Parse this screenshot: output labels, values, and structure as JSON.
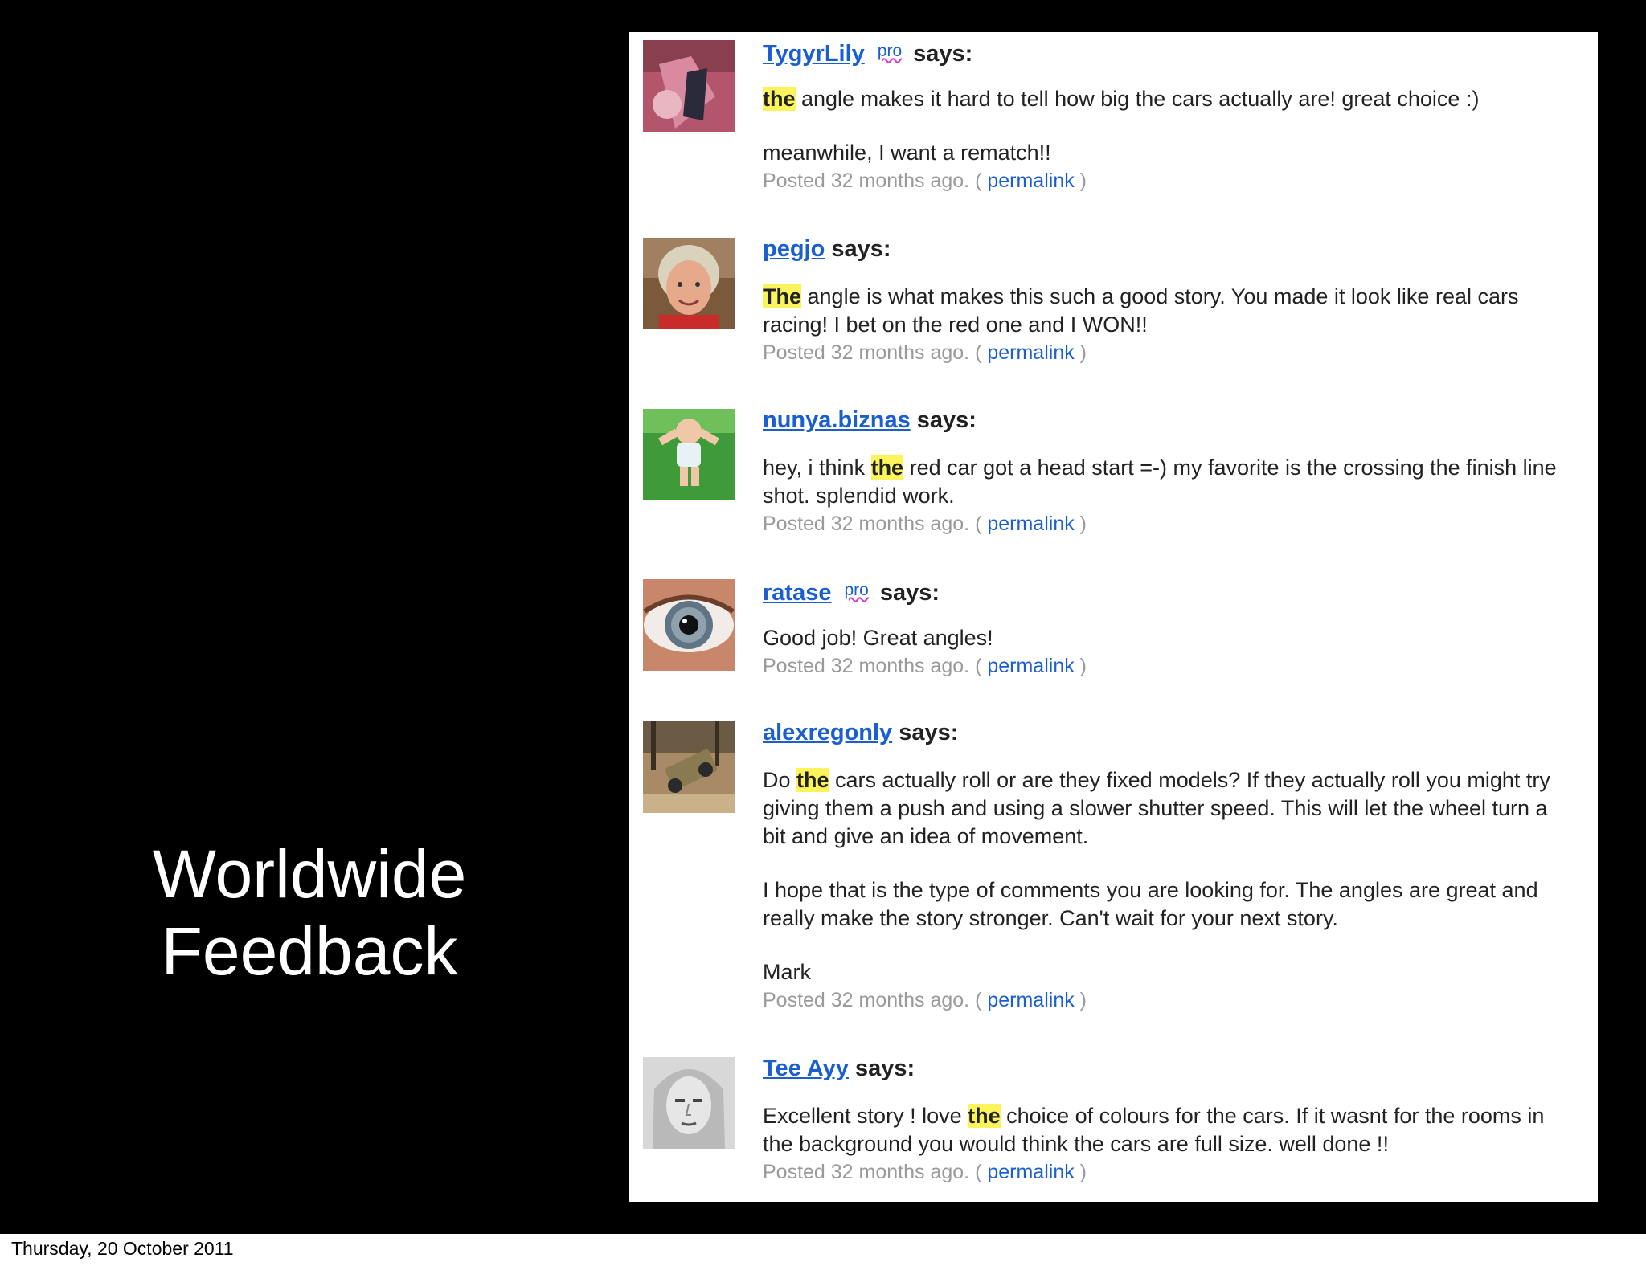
{
  "slide": {
    "title_line1": "Worldwide",
    "title_line2": "Feedback",
    "date": "Thursday, 20 October 2011",
    "background": "#000000"
  },
  "comments": [
    {
      "username": "TygyrLily",
      "badge": "pro",
      "says": "says:",
      "p1_hl": "the",
      "p1_rest": " angle makes it hard to tell how big the cars actually are! great choice :)",
      "p2": "meanwhile, I want a rematch!!",
      "posted": "Posted 32 months ago. (",
      "permalink": "permalink",
      "close": ")"
    },
    {
      "username": "pegjo",
      "says": "says:",
      "p1_hl": "The",
      "p1_rest": " angle is what makes this such a good story. You made it look like real cars racing! I bet on the red one and I WON!!",
      "posted": "Posted 32 months ago. (",
      "permalink": "permalink",
      "close": ")"
    },
    {
      "username": "nunya.biznas",
      "says": "says:",
      "p1_pre": "hey, i think ",
      "p1_hl": "the",
      "p1_rest": " red car got a head start =-) my favorite is the crossing the finish line shot. splendid work.",
      "posted": "Posted 32 months ago. (",
      "permalink": "permalink",
      "close": ")"
    },
    {
      "username": "ratase",
      "badge": "pro",
      "says": "says:",
      "p1": "Good job! Great angles!",
      "posted": "Posted 32 months ago. (",
      "permalink": "permalink",
      "close": ")"
    },
    {
      "username": "alexregonly",
      "says": "says:",
      "p1_pre": "Do ",
      "p1_hl": "the",
      "p1_rest": " cars actually roll or are they fixed models? If they actually roll you might try giving them a push and using a slower shutter speed. This will let the wheel turn a bit and give an idea of movement.",
      "p2": "I hope that is the type of comments you are looking for. The angles are great and really make the story stronger. Can't wait for your next story.",
      "p3": "Mark",
      "posted": "Posted 32 months ago. (",
      "permalink": "permalink",
      "close": ")"
    },
    {
      "username": "Tee Ayy",
      "says": "says:",
      "p1_pre": "Excellent story ! love ",
      "p1_hl": "the",
      "p1_rest": " choice of colours for the cars. If it wasnt for the rooms in the background you would think the cars are full size. well done !!",
      "posted": "Posted 32 months ago. (",
      "permalink": "permalink",
      "close": ")"
    }
  ],
  "colors": {
    "link": "#1a5fd0",
    "highlight": "#fbf45a",
    "meta": "#9a9a9a"
  }
}
